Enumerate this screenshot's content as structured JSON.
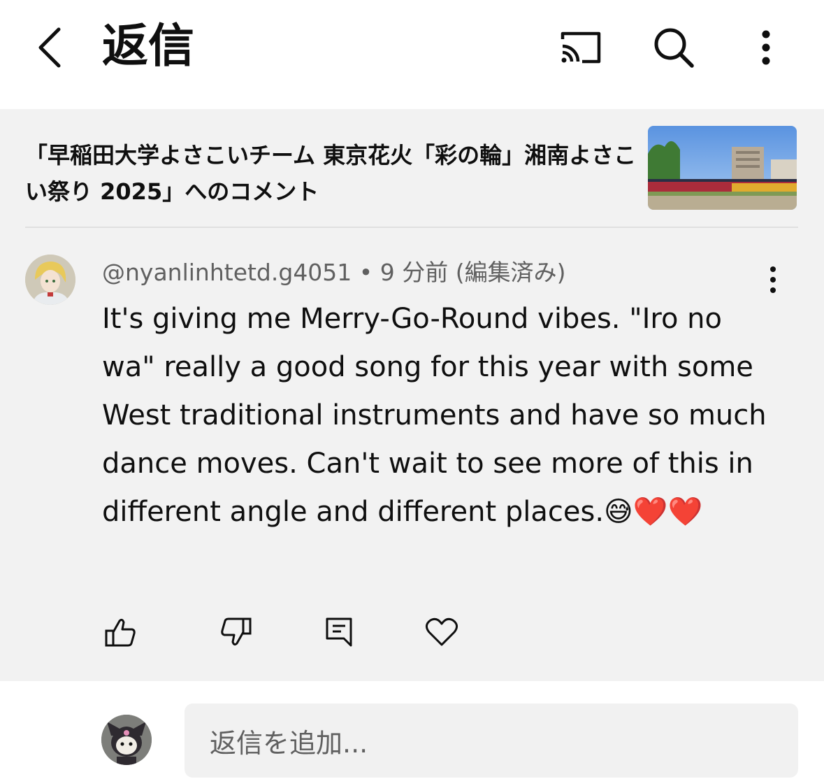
{
  "header": {
    "title": "返信"
  },
  "video": {
    "title": "「早稲田大学よさこいチーム 東京花火「彩の輪」湘南よさこい祭り 2025」へのコメント"
  },
  "comment": {
    "meta": "@nyanlinhtetd.g4051 • 9 分前 (編集済み)",
    "text": "It's giving me Merry-Go-Round vibes. \"Iro no wa\" really a good song for this year with some West traditional instruments and have so much dance moves. Can't wait to see more of this in different angle and different places.😅❤️❤️"
  },
  "reply": {
    "placeholder": "返信を追加..."
  },
  "icons": [
    "back-icon",
    "cast-icon",
    "search-icon",
    "more-vert-icon",
    "thumbs-up-icon",
    "thumbs-down-icon",
    "reply-icon",
    "heart-icon"
  ],
  "colors": {
    "panel_bg": "#f2f2f2",
    "text_primary": "#0f0f0f",
    "text_secondary": "#606060"
  }
}
